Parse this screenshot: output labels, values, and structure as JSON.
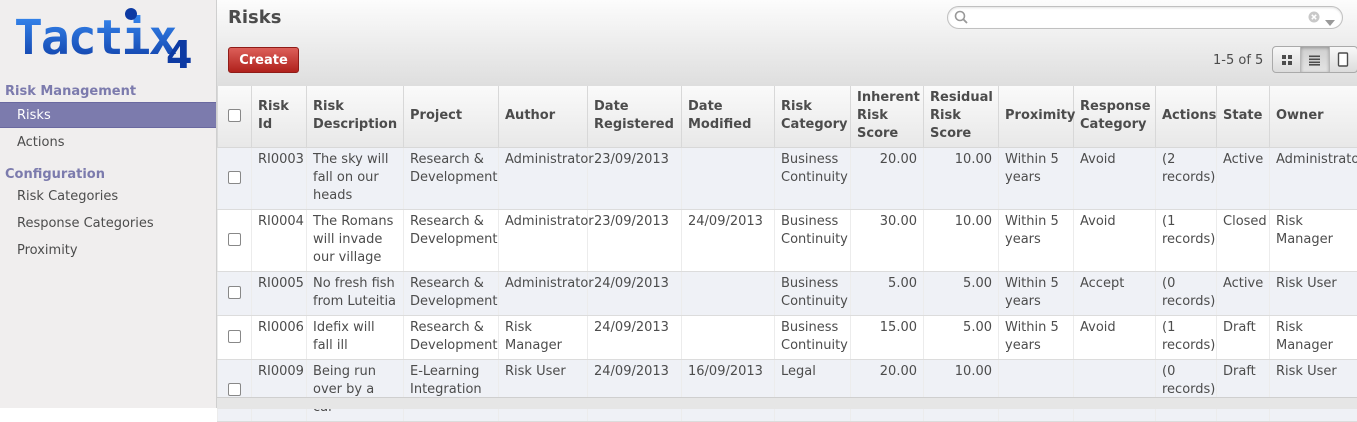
{
  "logo": {
    "text": "Tactix",
    "suffix": "4"
  },
  "sidebar": {
    "sections": [
      {
        "title": "Risk Management",
        "items": [
          {
            "label": "Risks",
            "active": true
          },
          {
            "label": "Actions",
            "active": false
          }
        ]
      },
      {
        "title": "Configuration",
        "items": [
          {
            "label": "Risk Categories"
          },
          {
            "label": "Response Categories"
          },
          {
            "label": "Proximity"
          }
        ]
      }
    ]
  },
  "header": {
    "title": "Risks",
    "create_label": "Create",
    "pager": "1-5 of 5",
    "search": {
      "value": "",
      "placeholder": ""
    }
  },
  "views": [
    "kanban-view-icon",
    "list-view-icon",
    "form-view-icon"
  ],
  "table": {
    "columns": [
      "Risk Id",
      "Risk Description",
      "Project",
      "Author",
      "Date Registered",
      "Date Modified",
      "Risk Category",
      "Inherent Risk Score",
      "Residual Risk Score",
      "Proximity",
      "Response Category",
      "Actions",
      "State",
      "Owner"
    ],
    "rows": [
      [
        "RI0003",
        "The sky will fall on our heads",
        "Research & Development",
        "Administrator",
        "23/09/2013",
        "",
        "Business Continuity",
        "20.00",
        "10.00",
        "Within 5 years",
        "Avoid",
        "(2 records)",
        "Active",
        "Administrator"
      ],
      [
        "RI0004",
        "The Romans will invade our village",
        "Research & Development",
        "Administrator",
        "23/09/2013",
        "24/09/2013",
        "Business Continuity",
        "30.00",
        "10.00",
        "Within 5 years",
        "Avoid",
        "(1 records)",
        "Closed",
        "Risk Manager"
      ],
      [
        "RI0005",
        "No fresh fish from Luteitia",
        "Research & Development",
        "Administrator",
        "24/09/2013",
        "",
        "Business Continuity",
        "5.00",
        "5.00",
        "Within 5 years",
        "Accept",
        "(0 records)",
        "Active",
        "Risk User"
      ],
      [
        "RI0006",
        "Idefix will fall ill",
        "Research & Development",
        "Risk Manager",
        "24/09/2013",
        "",
        "Business Continuity",
        "15.00",
        "5.00",
        "Within 5 years",
        "Avoid",
        "(1 records)",
        "Draft",
        "Risk Manager"
      ],
      [
        "RI0009",
        "Being run over by a car",
        "E-Learning Integration",
        "Risk User",
        "24/09/2013",
        "16/09/2013",
        "Legal",
        "20.00",
        "10.00",
        "",
        "",
        "(0 records)",
        "Draft",
        "Risk User"
      ]
    ]
  },
  "colors": {
    "accent": "#7c7bad",
    "create": "#c0302b",
    "logo_blue": "#1a6cd9",
    "logo_dark": "#0d3aa3"
  }
}
